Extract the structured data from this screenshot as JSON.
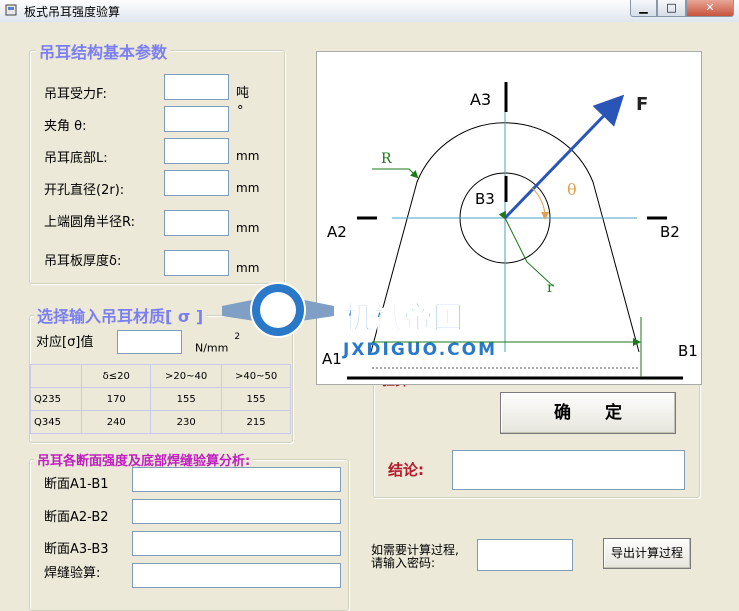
{
  "window": {
    "title": "板式吊耳强度验算",
    "min_label": "▁",
    "max_label": "□",
    "close_label": "✕"
  },
  "params": {
    "legend": "吊耳结构基本参数",
    "fields": [
      {
        "label": "吊耳受力F:",
        "value": "",
        "unit": "吨"
      },
      {
        "label": "夹角 θ:",
        "value": "",
        "unit": "°"
      },
      {
        "label": "吊耳底部L:",
        "value": "",
        "unit": "mm"
      },
      {
        "label": "开孔直径(2r):",
        "value": "",
        "unit": "mm"
      },
      {
        "label": "上端圆角半径R:",
        "value": "",
        "unit": "mm"
      },
      {
        "label": "吊耳板厚度δ:",
        "value": "",
        "unit": "mm"
      }
    ]
  },
  "material": {
    "legend": "选择输入吊耳材质[ σ ]",
    "label": "对应[σ]值",
    "value": "",
    "unit": "N/mm",
    "unit_sup": "2",
    "table": {
      "headers": [
        "",
        "δ≤20",
        ">20~40",
        ">40~50"
      ],
      "rows": [
        {
          "name": "Q235",
          "values": [
            "170",
            "155",
            "155"
          ]
        },
        {
          "name": "Q345",
          "values": [
            "240",
            "230",
            "215"
          ]
        }
      ]
    }
  },
  "analysis": {
    "legend": "吊耳各断面强度及底部焊缝验算分析:",
    "fields": [
      {
        "label": "断面A1-B1",
        "value": ""
      },
      {
        "label": "断面A2-B2",
        "value": ""
      },
      {
        "label": "断面A3-B3",
        "value": ""
      },
      {
        "label": "焊缝验算:",
        "value": ""
      }
    ]
  },
  "check": {
    "legend": "验算:",
    "confirm_label": "确　　定",
    "result_label": "结论:",
    "result_value": ""
  },
  "export": {
    "prompt_line1": "如需要计算过程,",
    "prompt_line2": "请输入密码:",
    "password_value": "",
    "button_label": "导出计算过程"
  },
  "diagram": {
    "labels": {
      "A1": "A1",
      "A2": "A2",
      "A3": "A3",
      "B1": "B1",
      "B2": "B2",
      "B3": "B3",
      "F": "F",
      "R": "R",
      "r": "r",
      "theta": "θ"
    },
    "watermark": {
      "title": "机械帝国",
      "subtitle": "JXDIGUO.COM",
      "badge": "JX"
    },
    "colors": {
      "force": "#2a55b8",
      "dim": "#1a7a1a",
      "theta": "#e0a050",
      "watermark": "#2a78c8"
    }
  }
}
